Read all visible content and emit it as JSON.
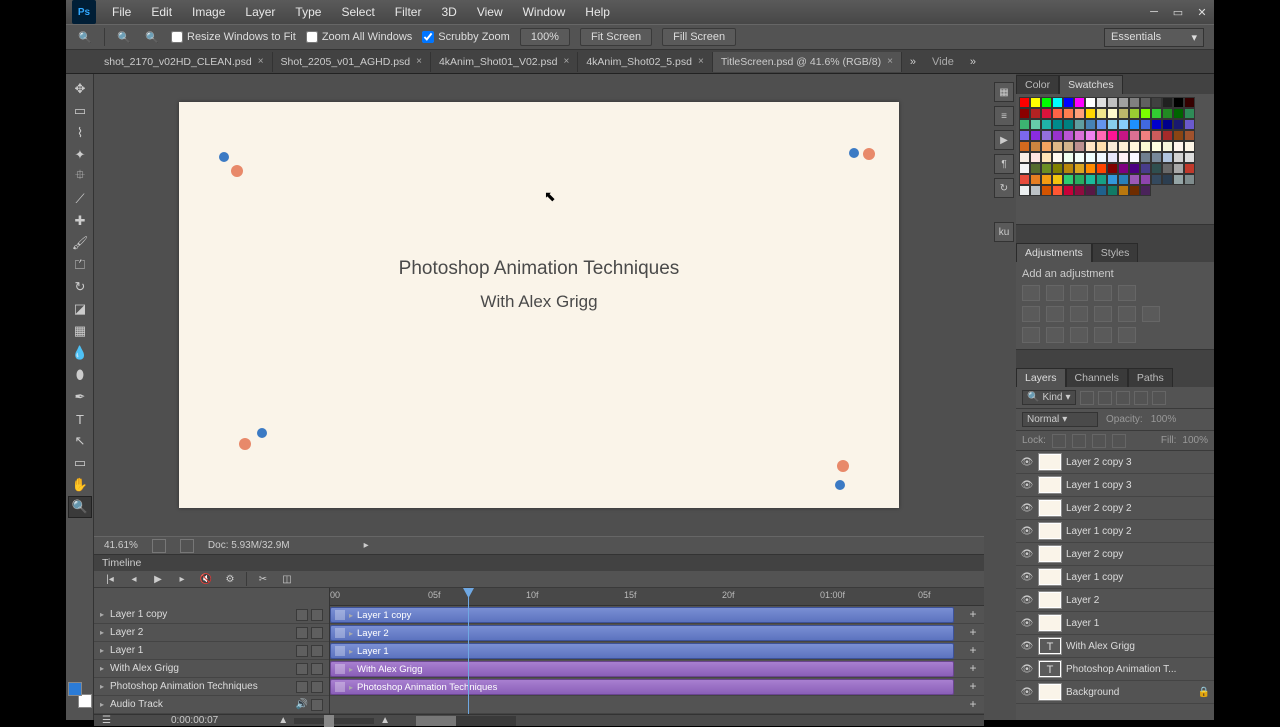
{
  "menu": [
    "File",
    "Edit",
    "Image",
    "Layer",
    "Type",
    "Select",
    "Filter",
    "3D",
    "View",
    "Window",
    "Help"
  ],
  "options": {
    "resize": "Resize Windows to Fit",
    "zoomAll": "Zoom All Windows",
    "scrubby": "Scrubby Zoom",
    "pct": "100%",
    "fit": "Fit Screen",
    "fill": "Fill Screen",
    "workspace": "Essentials"
  },
  "tabs": [
    {
      "label": "shot_2170_v02HD_CLEAN.psd"
    },
    {
      "label": "Shot_2205_v01_AGHD.psd"
    },
    {
      "label": "4kAnim_Shot01_V02.psd"
    },
    {
      "label": "4kAnim_Shot02_5.psd"
    },
    {
      "label": "TitleScreen.psd @ 41.6% (RGB/8)",
      "active": true
    }
  ],
  "tabExtra": "Vide",
  "canvas": {
    "line1": "Photoshop Animation Techniques",
    "line2": "With Alex Grigg"
  },
  "status": {
    "zoom": "41.61%",
    "doc": "Doc: 5.93M/32.9M"
  },
  "timeline": {
    "title": "Timeline",
    "ticks": [
      "00",
      "05f",
      "10f",
      "15f",
      "20f",
      "01:00f",
      "05f"
    ],
    "tracks": [
      {
        "label": "Layer 1 copy",
        "type": "video",
        "clip": "Layer 1 copy"
      },
      {
        "label": "Layer 2",
        "type": "video",
        "clip": "Layer 2"
      },
      {
        "label": "Layer 1",
        "type": "video",
        "clip": "Layer 1"
      },
      {
        "label": "With Alex Grigg",
        "type": "text",
        "clip": "With Alex Grigg"
      },
      {
        "label": "Photoshop Animation Techniques",
        "type": "text",
        "clip": "Photoshop Animation Techniques"
      },
      {
        "label": "Audio Track",
        "type": "audio"
      }
    ],
    "timecode": "0:00:00:07"
  },
  "panels": {
    "colorTabs": [
      "Color",
      "Swatches"
    ],
    "adjTabs": [
      "Adjustments",
      "Styles"
    ],
    "adjLabel": "Add an adjustment",
    "layerTabs": [
      "Layers",
      "Channels",
      "Paths"
    ],
    "kind": "Kind",
    "blend": "Normal",
    "opacity": "Opacity:",
    "opacityVal": "100%",
    "lock": "Lock:",
    "fill": "Fill:",
    "fillVal": "100%",
    "layers": [
      {
        "name": "Layer 2 copy 3",
        "t": "img"
      },
      {
        "name": "Layer 1 copy 3",
        "t": "img"
      },
      {
        "name": "Layer 2 copy 2",
        "t": "img"
      },
      {
        "name": "Layer 1 copy 2",
        "t": "img"
      },
      {
        "name": "Layer 2 copy",
        "t": "img"
      },
      {
        "name": "Layer 1 copy",
        "t": "img"
      },
      {
        "name": "Layer 2",
        "t": "img"
      },
      {
        "name": "Layer 1",
        "t": "img"
      },
      {
        "name": "With Alex Grigg",
        "t": "T"
      },
      {
        "name": "Photoshop Animation T...",
        "t": "T"
      },
      {
        "name": "Background",
        "t": "bg",
        "locked": true
      }
    ]
  },
  "swatchColors": [
    "#ff0000",
    "#ffff00",
    "#00ff00",
    "#00ffff",
    "#0000ff",
    "#ff00ff",
    "#ffffff",
    "#e0e0e0",
    "#c0c0c0",
    "#a0a0a0",
    "#808080",
    "#606060",
    "#404040",
    "#202020",
    "#000000",
    "#350000",
    "#8b0000",
    "#b22222",
    "#dc143c",
    "#ff6347",
    "#ff7f50",
    "#ffa07a",
    "#ffd700",
    "#f0e68c",
    "#fffacd",
    "#bdb76b",
    "#9acd32",
    "#7cfc00",
    "#32cd32",
    "#228b22",
    "#006400",
    "#2e8b57",
    "#3cb371",
    "#66cdaa",
    "#20b2aa",
    "#008b8b",
    "#008080",
    "#5f9ea0",
    "#4682b4",
    "#6495ed",
    "#87ceeb",
    "#87cefa",
    "#1e90ff",
    "#4169e1",
    "#0000cd",
    "#00008b",
    "#191970",
    "#6a5acd",
    "#7b68ee",
    "#8a2be2",
    "#9370db",
    "#9932cc",
    "#ba55d3",
    "#da70d6",
    "#ee82ee",
    "#ff69b4",
    "#ff1493",
    "#c71585",
    "#db7093",
    "#f08080",
    "#cd5c5c",
    "#a52a2a",
    "#8b4513",
    "#a0522d",
    "#d2691e",
    "#cd853f",
    "#f4a460",
    "#deb887",
    "#d2b48c",
    "#bc8f8f",
    "#ffe4c4",
    "#ffdead",
    "#faebd7",
    "#ffefd5",
    "#fff8dc",
    "#fafad2",
    "#ffffe0",
    "#f5f5dc",
    "#fff5ee",
    "#fdf5e6",
    "#faf0e6",
    "#ffe4e1",
    "#ffe4b5",
    "#fffaf0",
    "#f0fff0",
    "#f5fffa",
    "#f0ffff",
    "#f0f8ff",
    "#e6e6fa",
    "#fff0f5",
    "#f8f8ff",
    "#708090",
    "#778899",
    "#b0c4de",
    "#d3d3d3",
    "#dcdcdc",
    "#f5f5f5",
    "#556b2f",
    "#6b8e23",
    "#808000",
    "#b8860b",
    "#daa520",
    "#ff8c00",
    "#ff4500",
    "#800000",
    "#800080",
    "#4b0082",
    "#483d8b",
    "#2f4f4f",
    "#696969",
    "#a9a9a9",
    "#c0392b",
    "#e74c3c",
    "#e67e22",
    "#f39c12",
    "#f1c40f",
    "#2ecc71",
    "#27ae60",
    "#1abc9c",
    "#16a085",
    "#3498db",
    "#2980b9",
    "#9b59b6",
    "#8e44ad",
    "#34495e",
    "#2c3e50",
    "#95a5a6",
    "#7f8c8d",
    "#ecf0f1",
    "#bdc3c7",
    "#d35400",
    "#ff5733",
    "#c70039",
    "#900c3f",
    "#581845",
    "#1f618d",
    "#117a65",
    "#b9770e",
    "#6e2c00",
    "#4a235a"
  ]
}
